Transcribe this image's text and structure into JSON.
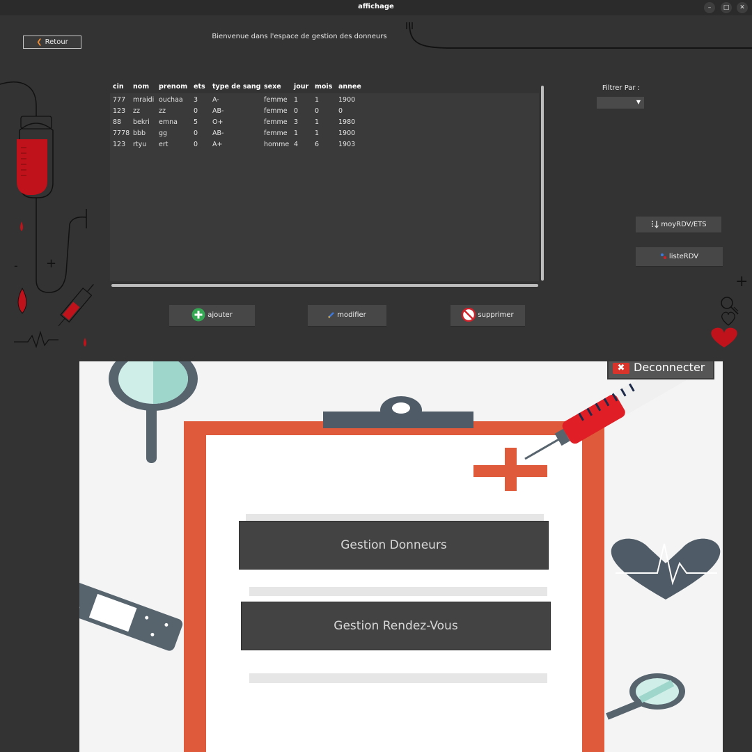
{
  "window": {
    "title": "affichage",
    "controls": {
      "minimize": "–",
      "maximize": "□",
      "close": "✕"
    }
  },
  "header": {
    "back_label": "Retour",
    "welcome": "Bienvenue dans l'espace de gestion des donneurs"
  },
  "table": {
    "columns": [
      "cin",
      "nom",
      "prenom",
      "ets",
      "type de sang",
      "sexe",
      "jour",
      "mois",
      "annee"
    ],
    "rows": [
      [
        "777",
        "mraidi",
        "ouchaa",
        "3",
        "A-",
        "femme",
        "1",
        "1",
        "1900"
      ],
      [
        "123",
        "zz",
        "zz",
        "0",
        "AB-",
        "femme",
        "0",
        "0",
        "0"
      ],
      [
        "88",
        "bekri",
        "emna",
        "5",
        "O+",
        "femme",
        "3",
        "1",
        "1980"
      ],
      [
        "7778",
        "bbb",
        "gg",
        "0",
        "AB-",
        "femme",
        "1",
        "1",
        "1900"
      ],
      [
        "123",
        "rtyu",
        "ert",
        "0",
        "A+",
        "homme",
        "4",
        "6",
        "1903"
      ]
    ]
  },
  "actions": {
    "ajouter": "ajouter",
    "modifier": "modifier",
    "supprimer": "supprimer"
  },
  "filter": {
    "label": "Filtrer Par :",
    "selected": ""
  },
  "side_buttons": {
    "moy": "moyRDV/ETS",
    "liste": "listeRDV"
  },
  "menu": {
    "deconnecter": "Deconnecter",
    "gestion_donneurs": "Gestion Donneurs",
    "gestion_rdv": "Gestion Rendez-Vous"
  },
  "colors": {
    "accent_red": "#c0121a",
    "clipboard_orange": "#de5a3a",
    "dark_bg": "#333333",
    "slate": "#4f5b66"
  }
}
